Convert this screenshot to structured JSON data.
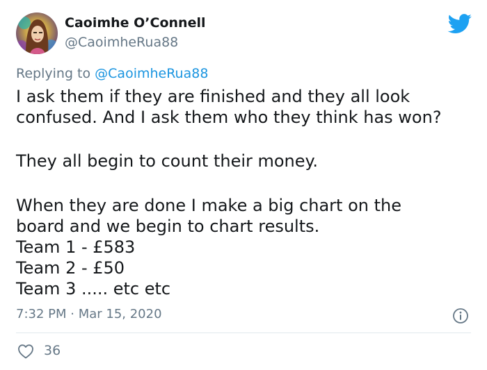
{
  "author": {
    "display_name": "Caoimhe O’Connell",
    "handle": "@CaoimheRua88"
  },
  "reply": {
    "prefix": "Replying to ",
    "mention": "@CaoimheRua88"
  },
  "body_lines": [
    "I ask them if they are finished and they all look",
    "confused. And I ask them who they think has won?",
    "They all begin to count their money.",
    "When they are done I make a big chart on the",
    "board and we begin to chart results.",
    "Team 1 - £583",
    "Team 2 - £50",
    "Team 3 ..... etc etc"
  ],
  "timestamp": "7:32 PM · Mar 15, 2020",
  "likes": "36",
  "colors": {
    "brand": "#1da1f2",
    "secondary_text": "#657786",
    "link": "#1b95e0"
  },
  "icons": {
    "logo": "twitter-bird-icon",
    "info": "info-icon",
    "like": "heart-icon"
  }
}
